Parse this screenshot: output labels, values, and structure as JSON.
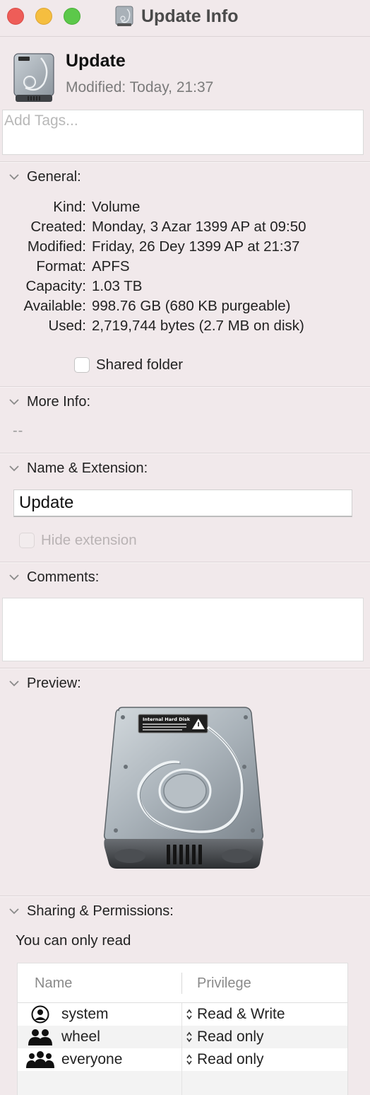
{
  "window": {
    "title": "Update Info"
  },
  "header": {
    "name": "Update",
    "modified": "Modified:  Today, 21:37"
  },
  "tags": {
    "placeholder": "Add Tags..."
  },
  "general": {
    "label": "General:",
    "rows": [
      {
        "key": "Kind:",
        "value": "Volume"
      },
      {
        "key": "Created:",
        "value": "Monday, 3 Azar 1399 AP at 09:50"
      },
      {
        "key": "Modified:",
        "value": "Friday, 26 Dey 1399 AP at 21:37"
      },
      {
        "key": "Format:",
        "value": "APFS"
      },
      {
        "key": "Capacity:",
        "value": "1.03 TB"
      },
      {
        "key": "Available:",
        "value": "998.76 GB (680 KB purgeable)"
      },
      {
        "key": "Used:",
        "value": "2,719,744 bytes (2.7 MB on disk)"
      }
    ],
    "shared_folder_label": "Shared folder",
    "shared_folder_checked": false
  },
  "more_info": {
    "label": "More Info:",
    "value": "--"
  },
  "name_extension": {
    "label": "Name & Extension:",
    "name_value": "Update",
    "hide_extension_label": "Hide extension",
    "hide_extension_checked": false,
    "hide_extension_disabled": true
  },
  "comments": {
    "label": "Comments:",
    "value": ""
  },
  "preview": {
    "label": "Preview:",
    "disk_sticker_title": "Internal Hard Disk"
  },
  "sharing": {
    "label": "Sharing & Permissions:",
    "note": "You can only read",
    "columns": {
      "name": "Name",
      "privilege": "Privilege"
    },
    "rows": [
      {
        "icon": "single-user-icon",
        "name": "system",
        "privilege": "Read & Write"
      },
      {
        "icon": "group-icon",
        "name": "wheel",
        "privilege": "Read only"
      },
      {
        "icon": "everyone-icon",
        "name": "everyone",
        "privilege": "Read only"
      }
    ]
  },
  "colors": {
    "window_bg": "#f1e9eb",
    "close": "#ee5d58",
    "minimize": "#f5be3f",
    "zoom": "#5cc84a"
  }
}
